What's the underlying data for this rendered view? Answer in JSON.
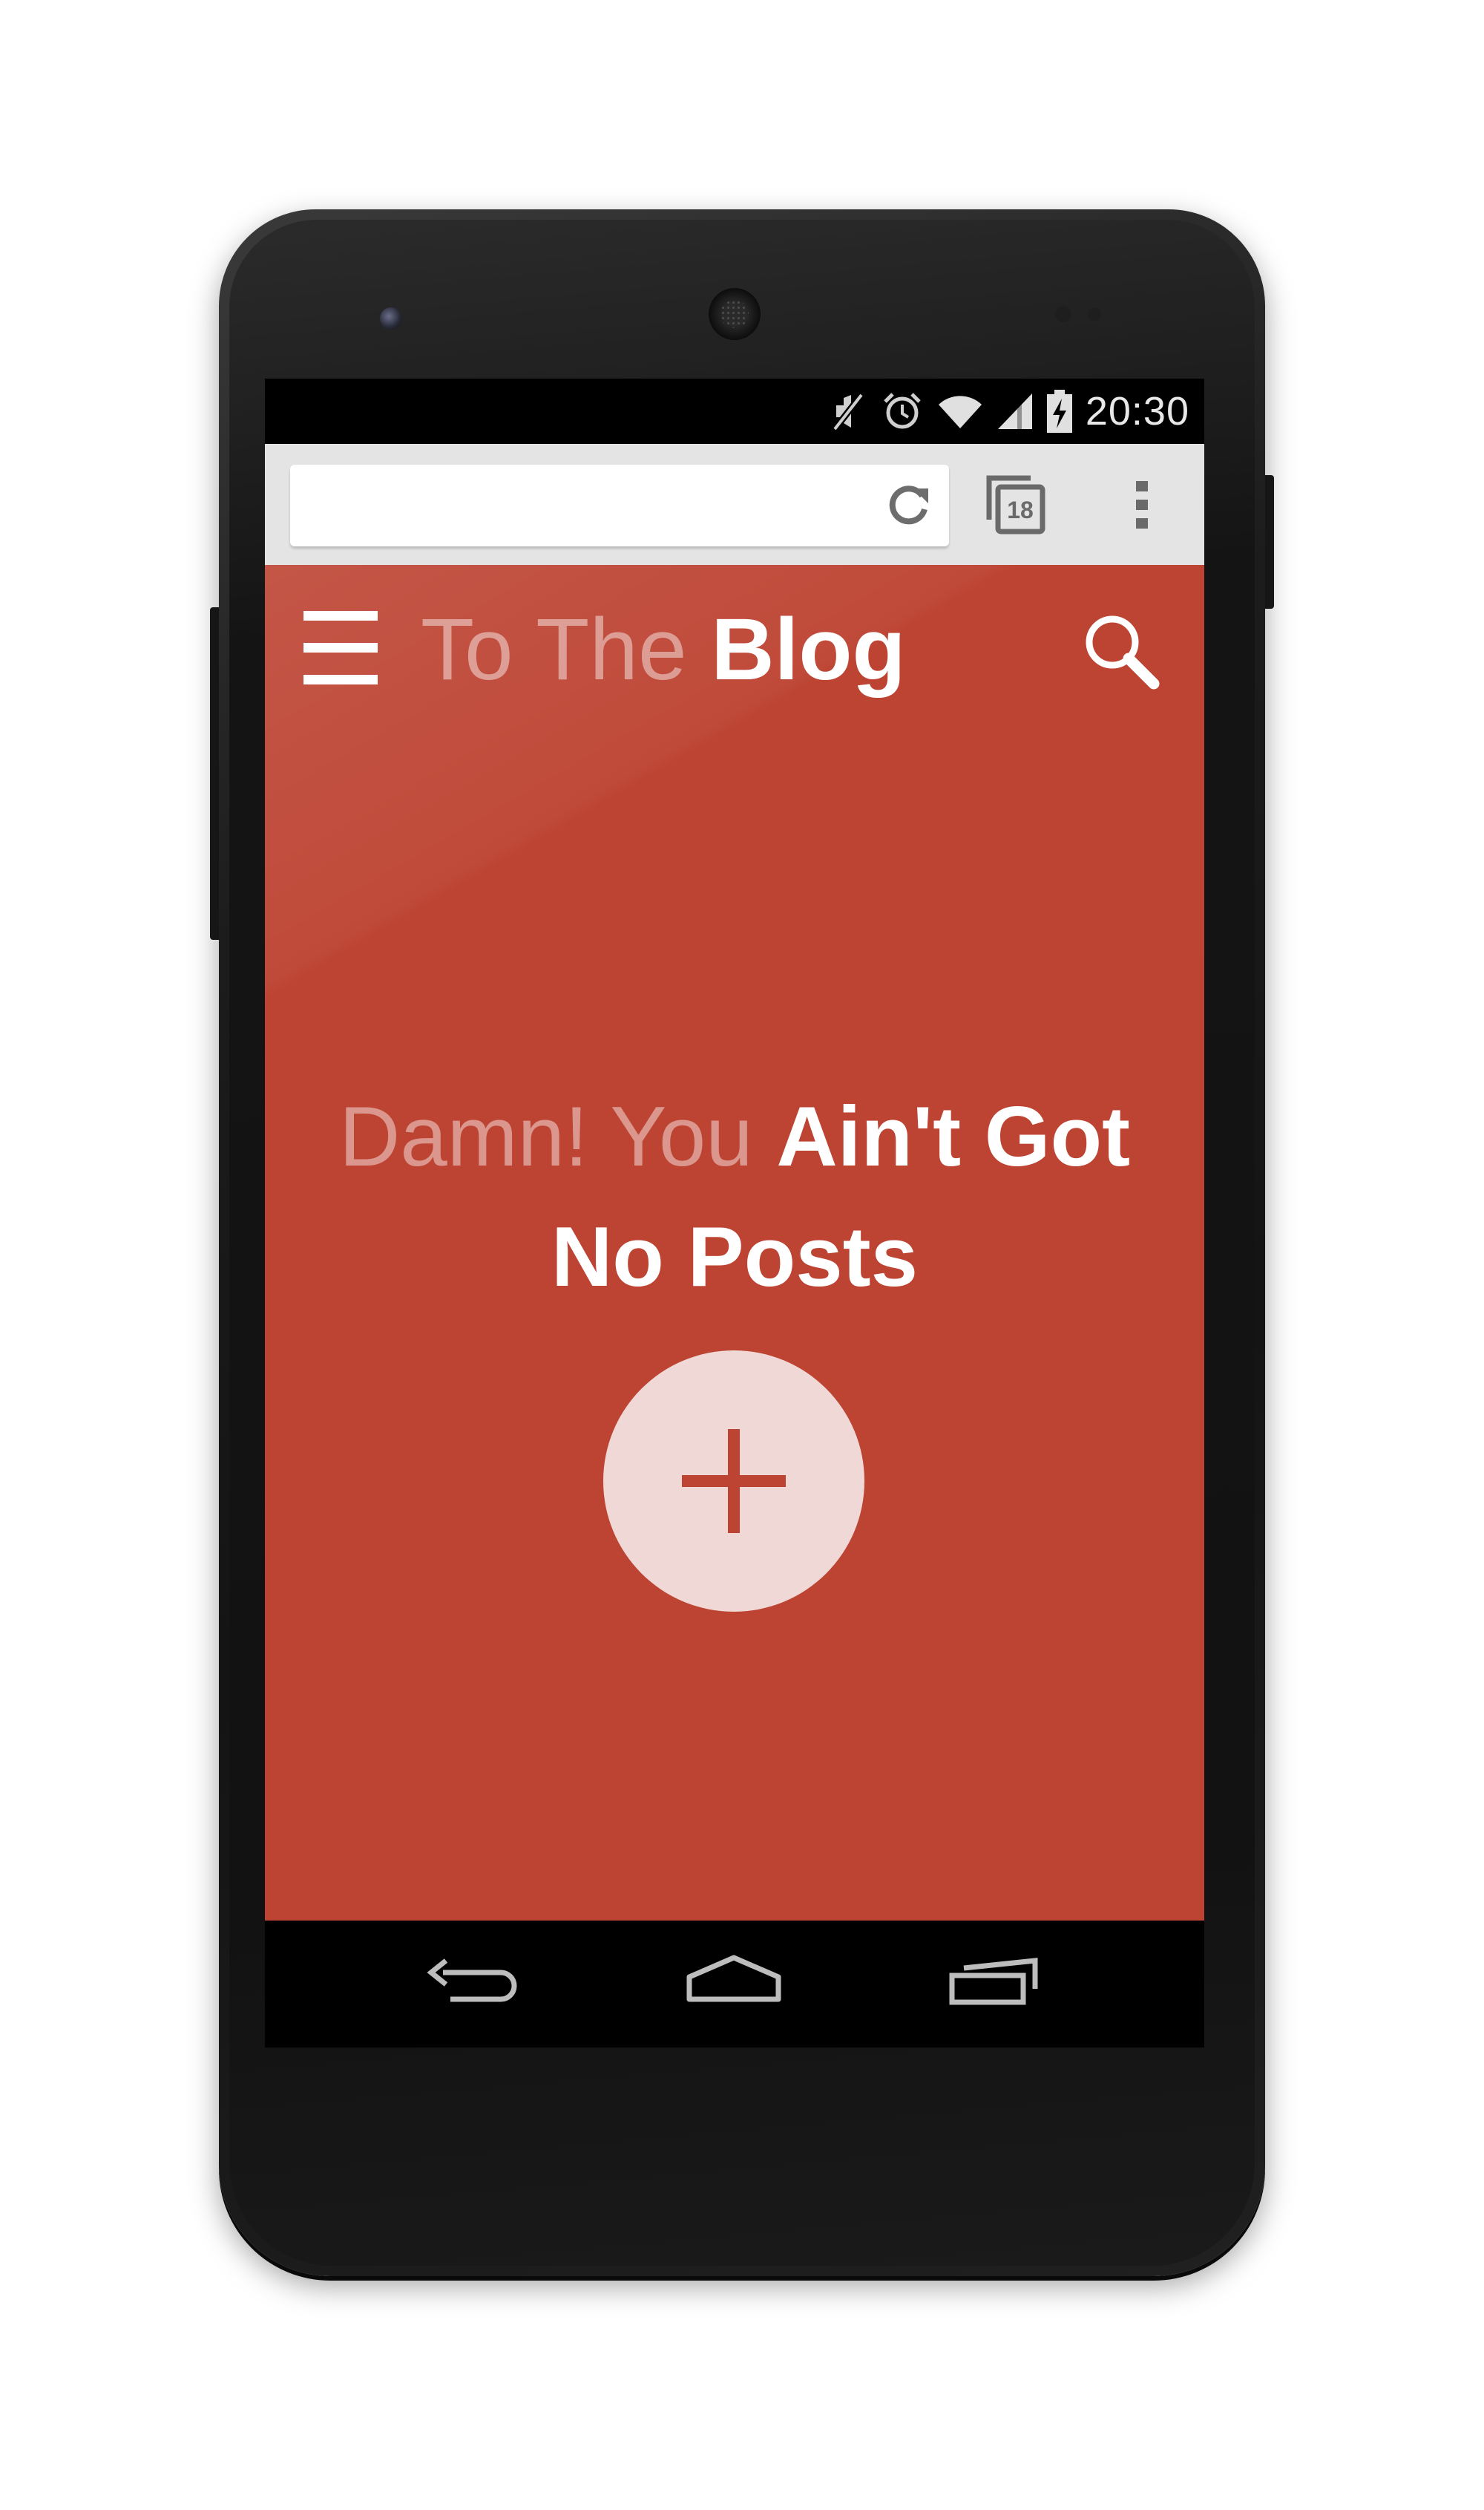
{
  "status_bar": {
    "time": "20:30",
    "icons": [
      "mute-icon",
      "alarm-icon",
      "wifi-icon",
      "signal-icon",
      "battery-charging-icon"
    ]
  },
  "browser": {
    "url_placeholder": "",
    "url_value": "",
    "tab_count": "18",
    "icons": [
      "reload-icon",
      "tabs-icon",
      "overflow-menu-icon"
    ]
  },
  "site": {
    "title_light": "To The",
    "title_bold": "Blog",
    "icons": [
      "hamburger-menu-icon",
      "search-icon"
    ]
  },
  "empty_state": {
    "light_text": "Damn! You",
    "bold_text": "Ain't Got No Posts",
    "add_icon": "plus-icon"
  },
  "nav_bar": {
    "icons": [
      "back-icon",
      "home-icon",
      "recents-icon"
    ]
  },
  "colors": {
    "accent": "#bd4332",
    "fab_background": "#efd8d5",
    "toolbar": "#e4e4e4"
  }
}
